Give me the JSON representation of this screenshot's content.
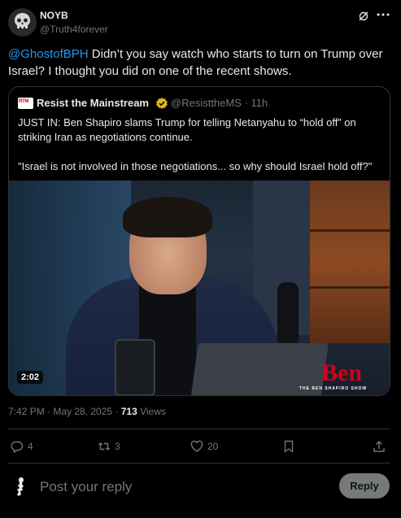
{
  "author": {
    "name": "NOYB",
    "handle": "@Truth4forever"
  },
  "tweet": {
    "mention": "@GhostofBPH",
    "text": " Didn’t you say watch who starts to turn on Trump over Israel? I thought you did on one of the recent shows."
  },
  "quote": {
    "avatar_text": "RTM",
    "name": "Resist the Mainstream",
    "handle_time": "@ResisttheMS · 11h",
    "text_1": "JUST IN: Ben Shapiro slams Trump for telling Netanyahu to “hold off” on striking Iran as negotiations continue.",
    "text_2": "\"Israel is not involved in those negotiations... so why should Israel hold off?\"",
    "video": {
      "duration": "2:02",
      "logo": "Ben",
      "logo_sub": "THE BEN SHAPIRO SHOW"
    }
  },
  "meta": {
    "time": "7:42 PM · May 28, 2025 · ",
    "views": "713",
    "views_label": " Views"
  },
  "actions": {
    "replies": "4",
    "reposts": "3",
    "likes": "20"
  },
  "reply": {
    "placeholder": "Post your reply",
    "button": "Reply"
  },
  "icons": [
    "skull-avatar-icon",
    "grok-icon",
    "more-icon",
    "verified-badge-icon",
    "reply-icon",
    "repost-icon",
    "like-icon",
    "bookmark-icon",
    "share-icon"
  ],
  "colors": {
    "link": "#1d9bf0",
    "muted": "#71767b",
    "verified": "#e2b719",
    "background": "#000000"
  }
}
